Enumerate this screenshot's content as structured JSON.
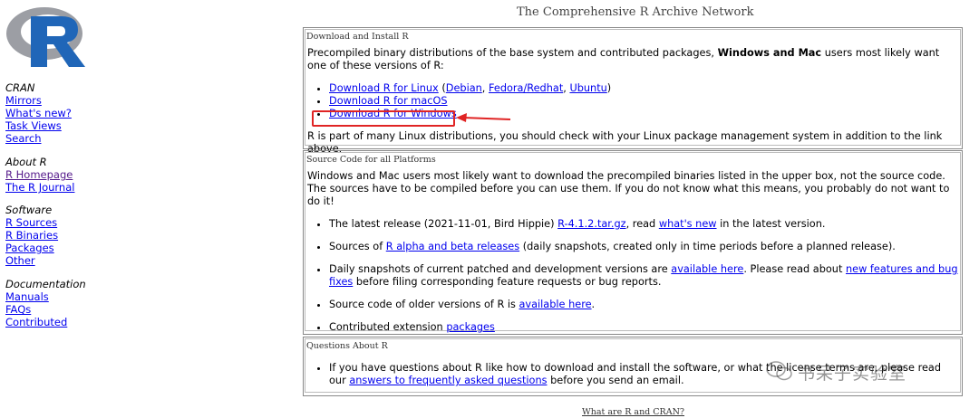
{
  "site_title": "The Comprehensive R Archive Network",
  "sidebar": {
    "groups": [
      {
        "header": "CRAN",
        "links": [
          "Mirrors",
          "What's new?",
          "Task Views",
          "Search"
        ]
      },
      {
        "header": "About R",
        "links": [
          "R Homepage",
          "The R Journal"
        ]
      },
      {
        "header": "Software",
        "links": [
          "R Sources",
          "R Binaries",
          "Packages",
          "Other"
        ]
      },
      {
        "header": "Documentation",
        "links": [
          "Manuals",
          "FAQs",
          "Contributed"
        ]
      }
    ]
  },
  "box1": {
    "title": "Download and Install R",
    "intro_pre": "Precompiled binary distributions of the base system and contributed packages, ",
    "intro_bold": "Windows and Mac",
    "intro_post": " users most likely want one of these versions of R:",
    "linux_link": "Download R for Linux",
    "linux_open": " (",
    "debian": "Debian",
    "sep1": ", ",
    "fedora": "Fedora/Redhat",
    "sep2": ", ",
    "ubuntu": "Ubuntu",
    "linux_close": ")",
    "macos_link": "Download R for macOS",
    "windows_link": "Download R for Windows",
    "outro": "R is part of many Linux distributions, you should check with your Linux package management system in addition to the link above."
  },
  "box2": {
    "title": "Source Code for all Platforms",
    "intro": "Windows and Mac users most likely want to download the precompiled binaries listed in the upper box, not the source code. The sources have to be compiled before you can use them. If you do not know what this means, you probably do not want to do it!",
    "item1_pre": "The latest release (2021-11-01, Bird Hippie) ",
    "item1_link": "R-4.1.2.tar.gz",
    "item1_mid": ", read ",
    "item1_link2": "what's new",
    "item1_post": " in the latest version.",
    "item2_pre": "Sources of ",
    "item2_link": "R alpha and beta releases",
    "item2_post": " (daily snapshots, created only in time periods before a planned release).",
    "item3_pre": "Daily snapshots of current patched and development versions are ",
    "item3_link": "available here",
    "item3_mid": ". Please read about ",
    "item3_link2": "new features and bug fixes",
    "item3_post": " before filing corresponding feature requests or bug reports.",
    "item4_pre": "Source code of older versions of R is ",
    "item4_link": "available here",
    "item4_post": ".",
    "item5_pre": "Contributed extension ",
    "item5_link": "packages"
  },
  "box3": {
    "title": "Questions About R",
    "item_pre": "If you have questions about R like how to download and install the software, or what the li",
    "item_mid": "cense terms are, please read our ",
    "item_link": "answers to frequently asked questions",
    "item_post": " before you send an email."
  },
  "watermark": "书呆子实验室",
  "footer": "What are R and CRAN?",
  "colors": {
    "link": "#0000ee",
    "visited": "#551a8b",
    "highlight": "#e02424"
  }
}
